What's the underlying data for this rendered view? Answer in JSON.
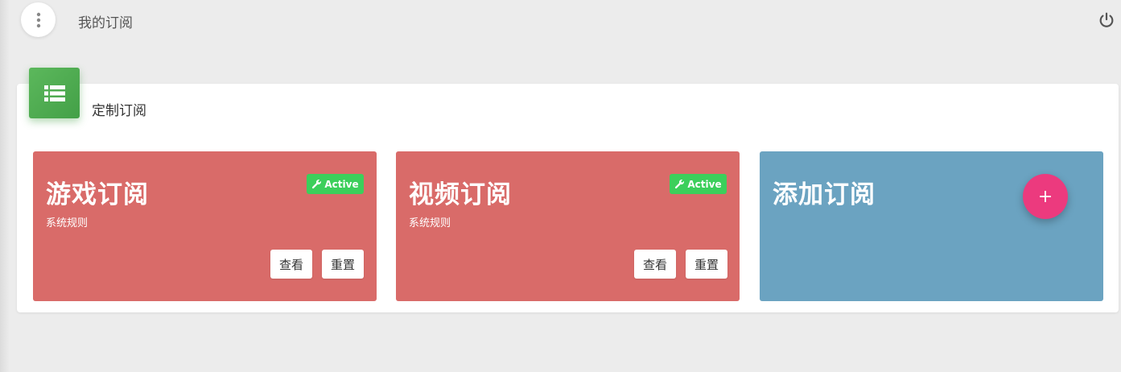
{
  "header": {
    "title": "我的订阅"
  },
  "panel": {
    "title": "定制订阅"
  },
  "cards": [
    {
      "title": "游戏订阅",
      "subtitle": "系统规则",
      "badge": "Active",
      "view_label": "查看",
      "reset_label": "重置"
    },
    {
      "title": "视频订阅",
      "subtitle": "系统规则",
      "badge": "Active",
      "view_label": "查看",
      "reset_label": "重置"
    }
  ],
  "add_card": {
    "title": "添加订阅",
    "button_label": "+"
  },
  "colors": {
    "card_red": "#d96b69",
    "card_blue": "#6ba3c1",
    "badge_green": "#3ccf5b",
    "fab_pink": "#ec3a7e",
    "panel_icon_green": "#4caf50"
  }
}
